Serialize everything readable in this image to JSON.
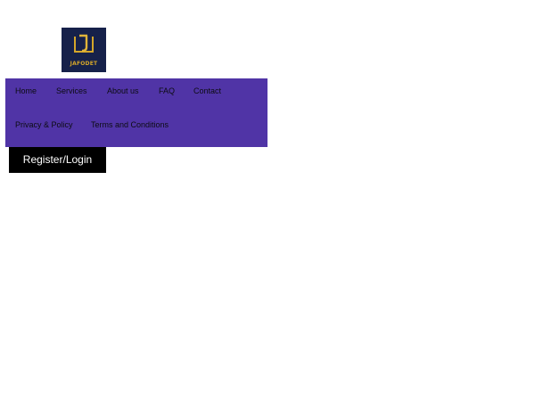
{
  "logo": {
    "text": "JAFODET"
  },
  "nav": {
    "items": [
      {
        "label": "Home"
      },
      {
        "label": "Services"
      },
      {
        "label": "About us"
      },
      {
        "label": "FAQ"
      },
      {
        "label": "Contact"
      },
      {
        "label": "Privacy & Policy"
      },
      {
        "label": "Terms and Conditions"
      }
    ]
  },
  "auth": {
    "register_label": "Register/Login"
  },
  "colors": {
    "nav_background": "#5034a6",
    "logo_background": "#16214a",
    "logo_gold": "#d4a62a",
    "button_background": "#000000"
  }
}
